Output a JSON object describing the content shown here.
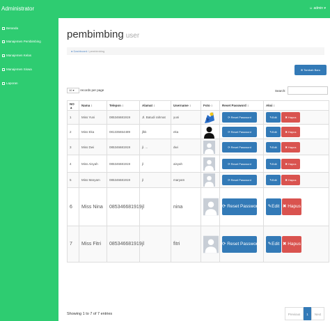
{
  "app": {
    "title": "Administrator",
    "user": "admin"
  },
  "sidebar": {
    "items": [
      {
        "label": "Beranda",
        "icon": "home-icon"
      },
      {
        "label": "Manajemen Pembimbing",
        "icon": "user-icon"
      },
      {
        "label": "Manajemen Kelas",
        "icon": "table-icon"
      },
      {
        "label": "Manajemen Siswa",
        "icon": "users-icon"
      },
      {
        "label": "Laporan",
        "icon": "print-icon"
      }
    ]
  },
  "page": {
    "title": "pembimbing",
    "subtitle": "user"
  },
  "breadcrumb": {
    "home": "Dashboard",
    "current": "pembimbing"
  },
  "toolbar": {
    "add_label": "Tambah Baru"
  },
  "datatable": {
    "length_label": "records per page",
    "length_value": "10",
    "search_label": "Search:",
    "info": "Showing 1 to 7 of 7 entries",
    "pagination": {
      "prev": "Previous",
      "page": "1",
      "next": "Next"
    }
  },
  "table": {
    "columns": [
      "NO",
      "Nama",
      "Telepon",
      "Alamat",
      "Username",
      "Foto",
      "Reset Password",
      "Aksi"
    ],
    "reset_label": "Reset Password",
    "edit_label": "Edit",
    "delete_label": "Hapus",
    "rows": [
      {
        "no": "1",
        "nama": "Miss Yuni",
        "telepon": "085346681919",
        "alamat": "Jl. Batudi rahmat",
        "username": "yuni",
        "photo": "colored"
      },
      {
        "no": "2",
        "nama": "Miss Eka",
        "telepon": "081335654489",
        "alamat": "jlkk",
        "username": "eka",
        "photo": "user"
      },
      {
        "no": "3",
        "nama": "Miss Dwi",
        "telepon": "085346681919",
        "alamat": "jl. ...",
        "username": "dwi",
        "photo": "placeholder"
      },
      {
        "no": "4",
        "nama": "Miss Aisyah",
        "telepon": "085346681919",
        "alamat": "jl",
        "username": "aisyah",
        "photo": "placeholder"
      },
      {
        "no": "5",
        "nama": "Miss Maryam",
        "telepon": "085346681919",
        "alamat": "jl",
        "username": "maryam",
        "photo": "placeholder"
      },
      {
        "no": "6",
        "nama": "Miss Nina",
        "telepon": "085346681919",
        "alamat": "jl",
        "username": "nina",
        "photo": "placeholder"
      },
      {
        "no": "7",
        "nama": "Miss Fitri",
        "telepon": "085346681919",
        "alamat": "jl",
        "username": "fitri",
        "photo": "placeholder"
      }
    ]
  },
  "colors": {
    "accent": "#2ecc71",
    "primary": "#337ab7",
    "danger": "#d9534f"
  }
}
